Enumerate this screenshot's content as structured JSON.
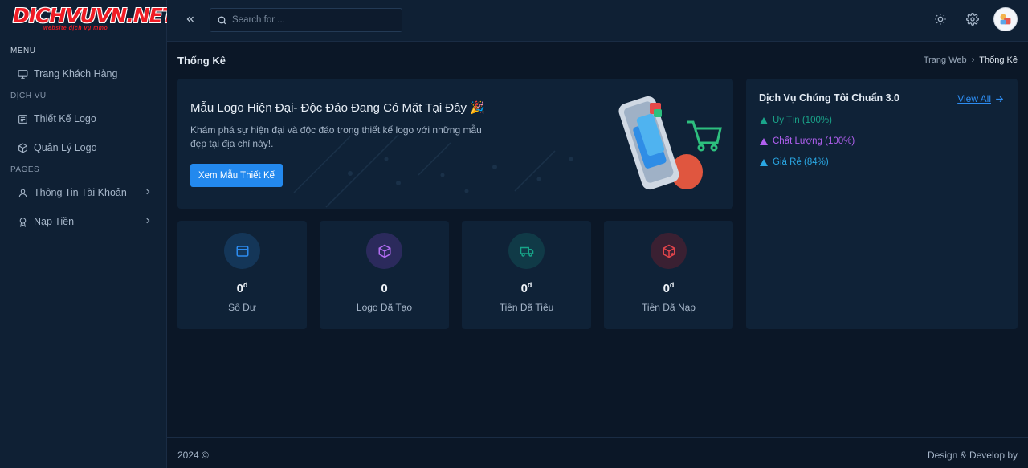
{
  "brand": {
    "name": "DICHVUVN.NET",
    "tagline": "website dịch vụ mmo"
  },
  "sidebar": {
    "sections": [
      {
        "title": "MENU",
        "items": [
          {
            "label": "Trang Khách Hàng",
            "icon": "monitor-icon"
          }
        ]
      },
      {
        "title": "DỊCH VỤ",
        "items": [
          {
            "label": "Thiết Kế Logo",
            "icon": "newspaper-icon"
          },
          {
            "label": "Quản Lý Logo",
            "icon": "box-icon"
          }
        ]
      },
      {
        "title": "PAGES",
        "items": [
          {
            "label": "Thông Tin Tài Khoản",
            "icon": "user-icon"
          },
          {
            "label": "Nạp Tiền",
            "icon": "award-icon"
          }
        ]
      }
    ]
  },
  "topbar": {
    "search_placeholder": "Search for ..."
  },
  "page": {
    "title": "Thống Kê",
    "breadcrumb": {
      "home": "Trang Web",
      "separator": "›",
      "current": "Thống Kê"
    }
  },
  "hero": {
    "title": "Mẫu Logo Hiện Đại- Độc Đáo Đang Có Mặt Tại Đây 🎉",
    "description": "Khám phá sự hiện đại và độc đáo trong thiết kế logo với những mẫu đẹp tại địa chỉ này!.",
    "button": "Xem Mẫu Thiết Kế"
  },
  "stats": [
    {
      "value": "0",
      "unit": "đ",
      "label": "Số Dư",
      "icon": "wallet-icon",
      "color": "#2d8cf0",
      "bg": "#143658"
    },
    {
      "value": "0",
      "unit": "",
      "label": "Logo Đã Tạo",
      "icon": "cube-icon",
      "color": "#b26cf2",
      "bg": "#2b2a5c"
    },
    {
      "value": "0",
      "unit": "đ",
      "label": "Tiền Đã Tiêu",
      "icon": "truck-icon",
      "color": "#17a589",
      "bg": "#103a47"
    },
    {
      "value": "0",
      "unit": "đ",
      "label": "Tiền Đã Nạp",
      "icon": "box-cross-icon",
      "color": "#e0444b",
      "bg": "#3a2032"
    }
  ],
  "services": {
    "title": "Dịch Vụ Chúng Tôi Chuẩn 3.0",
    "view_all": "View All",
    "items": [
      {
        "label": "Uy Tín (100%)",
        "color": "#1aa58a"
      },
      {
        "label": "Chất Lượng (100%)",
        "color": "#b160f0"
      },
      {
        "label": "Giá Rẻ (84%)",
        "color": "#2aa7e3"
      }
    ]
  },
  "footer": {
    "left": "2024 ©",
    "right": "Design & Develop by"
  }
}
